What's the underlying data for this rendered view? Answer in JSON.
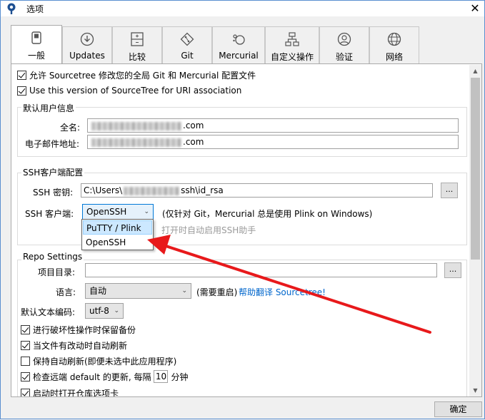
{
  "window": {
    "title": "选项",
    "close_glyph": "✕",
    "ok_label": "确定"
  },
  "tabs": [
    {
      "label": "一般",
      "icon": "general-switch-icon",
      "active": true
    },
    {
      "label": "Updates",
      "icon": "download-arrow-icon"
    },
    {
      "label": "比较",
      "icon": "compare-icon"
    },
    {
      "label": "Git",
      "icon": "git-diamond-icon"
    },
    {
      "label": "Mercurial",
      "icon": "mercurial-drop-icon"
    },
    {
      "label": "自定义操作",
      "icon": "custom-actions-icon"
    },
    {
      "label": "验证",
      "icon": "user-auth-icon"
    },
    {
      "label": "网络",
      "icon": "globe-icon"
    }
  ],
  "top_checks": [
    {
      "label": "允许 Sourcetree 修改您的全局 Git 和 Mercurial 配置文件",
      "checked": true
    },
    {
      "label": "Use this version of SourceTree for URI association",
      "checked": true
    }
  ],
  "user_info": {
    "title": "默认用户信息",
    "fullname_label": "全名:",
    "fullname_suffix": ".com",
    "email_label": "电子邮件地址:",
    "email_suffix": ".com"
  },
  "ssh": {
    "title": "SSH客户端配置",
    "key_label": "SSH 密钥:",
    "key_prefix": "C:\\Users\\",
    "key_suffix": "ssh\\id_rsa",
    "browse_label": "...",
    "client_label": "SSH 客户端:",
    "client_value": "OpenSSH",
    "client_note": "(仅针对 Git，Mercurial 总是使用 Plink on Windows)",
    "agent_hint": "打开时自动启用SSH助手",
    "options": [
      "PuTTY / Plink",
      "OpenSSH"
    ],
    "highlighted_option": "PuTTY / Plink"
  },
  "repo": {
    "title": "Repo Settings",
    "project_dir_label": "项目目录:",
    "project_dir_value": "",
    "browse_label": "...",
    "language_label": "语言:",
    "language_value": "自动",
    "restart_note": "(需要重启)",
    "translate_link": "帮助翻译 Sourcetree!",
    "encoding_label": "默认文本编码:",
    "encoding_value": "utf-8",
    "checks": [
      {
        "label": "进行破坏性操作时保留备份",
        "checked": true
      },
      {
        "label": "当文件有改动时自动刷新",
        "checked": true
      },
      {
        "label": "保持自动刷新(即便未选中此应用程序)",
        "checked": false
      }
    ],
    "remote_check_prefix": "检查远端 default 的更新, 每隔",
    "remote_check_interval": "10",
    "remote_check_unit": "分钟",
    "remote_check_on": true,
    "open_tab_label": "启动时打开仓库选项卡",
    "open_tab_on": true
  },
  "colors": {
    "annotation_arrow": "#e8191b",
    "link": "#0066cc",
    "highlight": "#cce8ff"
  }
}
